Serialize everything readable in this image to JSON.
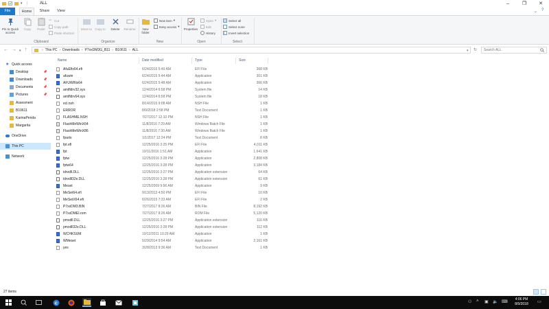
{
  "window": {
    "title": "ALL"
  },
  "colors": {
    "accent": "#1979ca",
    "selection": "#cce8ff",
    "folder": "#e8b83c"
  },
  "ribbon_tabs": [
    {
      "label": "File"
    },
    {
      "label": "Home"
    },
    {
      "label": "Share"
    },
    {
      "label": "View"
    }
  ],
  "ribbon": {
    "clipboard": {
      "pin": "Pin to Quick access",
      "copy": "Copy",
      "paste": "Paste",
      "cut": "Cut",
      "copy_path": "Copy path",
      "paste_shortcut": "Paste shortcut",
      "label": "Clipboard"
    },
    "organize": {
      "move_to": "Move to",
      "copy_to": "Copy to",
      "delete": "Delete",
      "rename": "Rename",
      "label": "Organize"
    },
    "new": {
      "new_folder": "New folder",
      "new_item": "New item",
      "easy_access": "Easy access",
      "label": "New"
    },
    "open": {
      "properties": "Properties",
      "open": "Open",
      "edit": "Edit",
      "history": "History",
      "label": "Open"
    },
    "select": {
      "select_all": "Select all",
      "select_none": "Select none",
      "invert": "Invert selection",
      "label": "Select"
    }
  },
  "address": {
    "crumbs": [
      "This PC",
      "Downloads",
      "P7xxDM3G_B11",
      "B10611",
      "ALL"
    ],
    "search_placeholder": "Search ALL"
  },
  "nav": [
    {
      "label": "Quick access",
      "icon": "star-icon"
    },
    {
      "label": "Desktop",
      "icon": "desktop-icon",
      "pinned": true
    },
    {
      "label": "Downloads",
      "icon": "download-icon",
      "pinned": true
    },
    {
      "label": "Documents",
      "icon": "documents-icon",
      "pinned": true
    },
    {
      "label": "Pictures",
      "icon": "pictures-icon",
      "pinned": true
    },
    {
      "label": "Assesment",
      "icon": "folder-icon"
    },
    {
      "label": "B10611",
      "icon": "folder-icon"
    },
    {
      "label": "KarinaPenda",
      "icon": "folder-icon"
    },
    {
      "label": "Margarita",
      "icon": "folder-icon"
    },
    {
      "label": "OneDrive",
      "icon": "cloud-icon"
    },
    {
      "label": "This PC",
      "icon": "computer-icon"
    },
    {
      "label": "Network",
      "icon": "network-icon"
    }
  ],
  "columns": {
    "name": "Name",
    "date": "Date modified",
    "type": "Type",
    "size": "Size"
  },
  "files": [
    {
      "name": "AfuEfix64.efi",
      "date": "6/24/2015 5:49 AM",
      "type": "EFI File",
      "size": "368 KB",
      "kind": "file"
    },
    {
      "name": "afuwin",
      "date": "6/24/2015 5:44 AM",
      "type": "Application",
      "size": "301 KB",
      "kind": "app"
    },
    {
      "name": "AFUWINx64",
      "date": "6/24/2015 5:48 AM",
      "type": "Application",
      "size": "366 KB",
      "kind": "app"
    },
    {
      "name": "amifldrv32.sys",
      "date": "12/4/2014 6:58 PM",
      "type": "System file",
      "size": "14 KB",
      "kind": "sys"
    },
    {
      "name": "amifldrv64.sys",
      "date": "12/4/2014 6:58 PM",
      "type": "System file",
      "size": "18 KB",
      "kind": "sys"
    },
    {
      "name": "ecl.nsh",
      "date": "8/14/2015 9:08 AM",
      "type": "NSH File",
      "size": "1 KB",
      "kind": "file"
    },
    {
      "name": "ERROR",
      "date": "8/9/2018 2:58 PM",
      "type": "Text Document",
      "size": "1 KB",
      "kind": "file"
    },
    {
      "name": "FLASHME.NSH",
      "date": "7/27/2017 12:10 PM",
      "type": "NSH File",
      "size": "1 KB",
      "kind": "file"
    },
    {
      "name": "FlashMeWinX64",
      "date": "11/8/2016 7:29 AM",
      "type": "Windows Batch File",
      "size": "1 KB",
      "kind": "bat"
    },
    {
      "name": "FlashMeWinX86",
      "date": "11/8/2016 7:30 AM",
      "type": "Windows Batch File",
      "size": "1 KB",
      "kind": "bat"
    },
    {
      "name": "fparts",
      "date": "1/1/2017 12:24 PM",
      "type": "Text Document",
      "size": "8 KB",
      "kind": "file"
    },
    {
      "name": "fpt.efi",
      "date": "12/25/2016 3:25 PM",
      "type": "EFI File",
      "size": "4,011 KB",
      "kind": "file"
    },
    {
      "name": "fpt",
      "date": "10/11/2016 1:51 AM",
      "type": "Application",
      "size": "1,641 KB",
      "kind": "app"
    },
    {
      "name": "fptw",
      "date": "12/25/2016 3:28 PM",
      "type": "Application",
      "size": "2,808 KB",
      "kind": "app"
    },
    {
      "name": "fptw64",
      "date": "12/25/2016 3:28 PM",
      "type": "Application",
      "size": "3,184 KB",
      "kind": "app"
    },
    {
      "name": "idrvdll.DLL",
      "date": "12/25/2016 3:27 PM",
      "type": "Application extension",
      "size": "64 KB",
      "kind": "sys"
    },
    {
      "name": "idrvdll32e.DLL",
      "date": "12/25/2016 3:28 PM",
      "type": "Application extension",
      "size": "61 KB",
      "kind": "sys"
    },
    {
      "name": "Meset",
      "date": "12/25/2009 9:56 AM",
      "type": "Application",
      "size": "9 KB",
      "kind": "app"
    },
    {
      "name": "MeSet64.efi",
      "date": "9/13/2013 4:50 PM",
      "type": "EFI File",
      "size": "10 KB",
      "kind": "file"
    },
    {
      "name": "MeSetX64.efi",
      "date": "6/26/2015 7:33 AM",
      "type": "EFI File",
      "size": "2 KB",
      "kind": "file"
    },
    {
      "name": "P7xxDM3.BIN",
      "date": "7/27/2017 8:26 AM",
      "type": "BIN File",
      "size": "8,192 KB",
      "kind": "file"
    },
    {
      "name": "P7xxDMEI.rom",
      "date": "7/27/2017 8:26 AM",
      "type": "ROM File",
      "size": "5,120 KB",
      "kind": "file"
    },
    {
      "name": "pmxdll.DLL",
      "date": "12/25/2016 3:27 PM",
      "type": "Application extension",
      "size": "116 KB",
      "kind": "sys"
    },
    {
      "name": "pmxdll32e.DLL",
      "date": "12/25/2016 3:28 PM",
      "type": "Application extension",
      "size": "112 KB",
      "kind": "sys"
    },
    {
      "name": "WCHKSUM",
      "date": "10/12/2011 10:29 AM",
      "type": "Application",
      "size": "1 KB",
      "kind": "app"
    },
    {
      "name": "WMeset",
      "date": "5/29/2014 9:54 AM",
      "type": "Application",
      "size": "2,161 KB",
      "kind": "app"
    },
    {
      "name": "yes",
      "date": "3/28/2013 9:36 AM",
      "type": "Text Document",
      "size": "1 KB",
      "kind": "file"
    }
  ],
  "status": {
    "items": "27 items"
  },
  "taskbar": {
    "time": "4:06 PM",
    "date": "8/9/2018"
  }
}
